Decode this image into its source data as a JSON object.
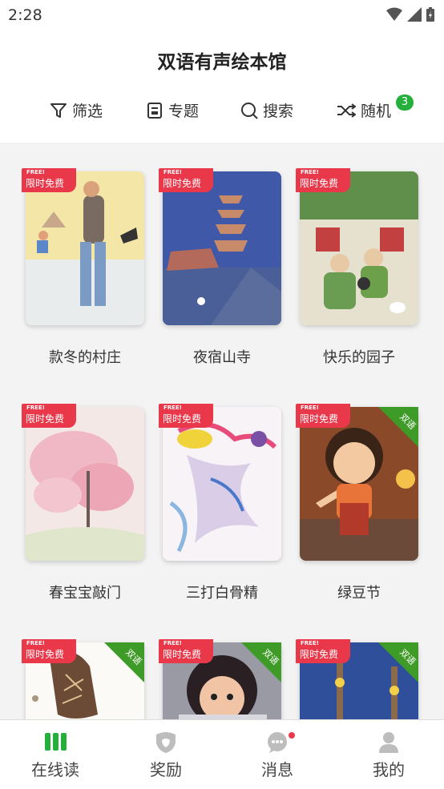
{
  "status_bar": {
    "time": "2:28"
  },
  "header": {
    "title": "双语有声绘本馆"
  },
  "toolbar": {
    "filter_label": "筛选",
    "topic_label": "专题",
    "search_label": "搜索",
    "random_label": "随机",
    "random_badge": "3"
  },
  "tags": {
    "free_small": "FREE!",
    "free_main": "限时免费",
    "bilingual": "双语"
  },
  "books": [
    {
      "title": "款冬的村庄",
      "free": true,
      "bilingual": false
    },
    {
      "title": "夜宿山寺",
      "free": true,
      "bilingual": false
    },
    {
      "title": "快乐的园子",
      "free": true,
      "bilingual": false
    },
    {
      "title": "春宝宝敲门",
      "free": true,
      "bilingual": false
    },
    {
      "title": "三打白骨精",
      "free": true,
      "bilingual": false
    },
    {
      "title": "绿豆节",
      "free": true,
      "bilingual": true
    },
    {
      "title": "",
      "free": true,
      "bilingual": true
    },
    {
      "title": "",
      "free": true,
      "bilingual": true
    },
    {
      "title": "",
      "free": true,
      "bilingual": true
    }
  ],
  "tabbar": {
    "read_label": "在线读",
    "reward_label": "奖励",
    "message_label": "消息",
    "me_label": "我的"
  },
  "colors": {
    "accent_green": "#25b03c",
    "free_red": "#e8384a",
    "bilingual_green": "#3f9b27"
  }
}
